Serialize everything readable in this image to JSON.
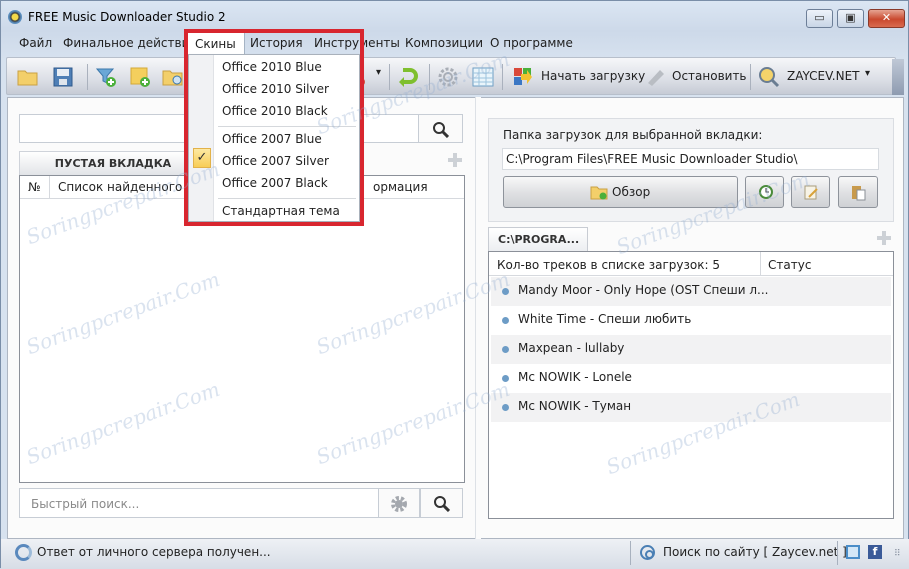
{
  "window": {
    "title": "FREE Music Downloader Studio 2",
    "controls": {
      "minimize": "▭",
      "maximize": "▣",
      "close": "✕"
    }
  },
  "menubar": {
    "items": [
      {
        "label": "Файл"
      },
      {
        "label": "Финальное действие"
      },
      {
        "label": "Скины",
        "open": true
      },
      {
        "label": "История"
      },
      {
        "label": "Инструменты"
      },
      {
        "label": "Композиции"
      },
      {
        "label": "О программе"
      }
    ]
  },
  "skins_menu": {
    "items": [
      {
        "label": "Office 2010 Blue"
      },
      {
        "label": "Office 2010 Silver"
      },
      {
        "label": "Office 2010 Black"
      },
      {
        "label": "Office 2007 Blue"
      },
      {
        "label": "Office 2007 Silver",
        "checked": true
      },
      {
        "label": "Office 2007 Black"
      },
      {
        "label": "Стандартная тема"
      }
    ],
    "check_mark": "✓"
  },
  "toolbar": {
    "start_download": "Начать загрузку",
    "stop": "Остановить",
    "source": "ZAYCEV.NET",
    "dropdown_arrow": "▾"
  },
  "left_panel": {
    "search_value": "",
    "tab_label": "ПУСТАЯ ВКЛАДКА",
    "columns": [
      "№",
      "Список найденного пу...",
      "...ормация"
    ],
    "col_num": "№",
    "col_list": "Список найденного пу",
    "col_info": "ормация",
    "quick_search_placeholder": "Быстрый поиск..."
  },
  "right_panel": {
    "folder_label": "Папка загрузок для выбранной вкладки:",
    "folder_path": "C:\\Program Files\\FREE Music Downloader Studio\\",
    "browse_label": "Обзор",
    "tab_label": "C:\\PROGRA...",
    "count_header": "Кол-во треков в списке загрузок: 5",
    "status_header": "Статус",
    "tracks": [
      {
        "title": "Mandy Moor - Only Hope (OST Спеши л..."
      },
      {
        "title": "White Time - Спеши любить"
      },
      {
        "title": "Maxpean - lullaby"
      },
      {
        "title": "Mc NOWIK - Lonele"
      },
      {
        "title": "Mc NOWIK - Туман"
      }
    ]
  },
  "statusbar": {
    "left_text": "Ответ от личного сервера получен...",
    "right_text": "Поиск по сайту [ Zaycev.net ]",
    "facebook": "f"
  },
  "watermark": "Soringpcrepair.Com",
  "colors": {
    "highlight": "#d8262f",
    "accent": "#6d9cc6"
  }
}
